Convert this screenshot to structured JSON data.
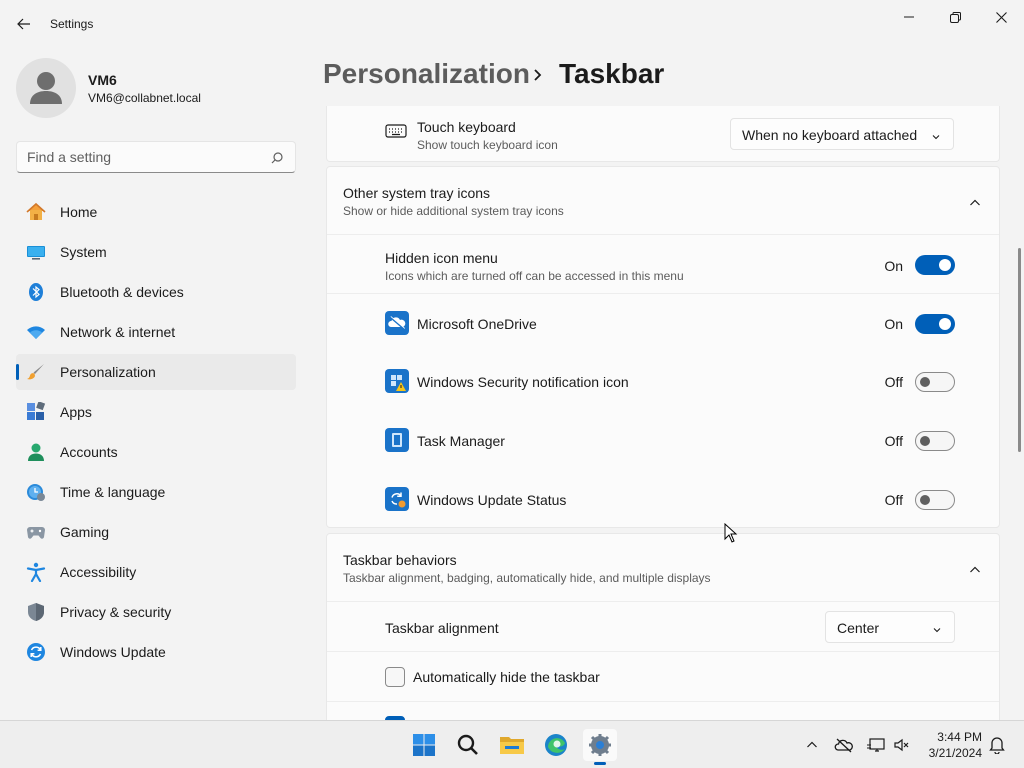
{
  "window": {
    "app_title": "Settings"
  },
  "profile": {
    "name": "VM6",
    "email": "VM6@collabnet.local"
  },
  "search": {
    "placeholder": "Find a setting"
  },
  "nav": {
    "items": [
      {
        "label": "Home",
        "icon": "home-icon"
      },
      {
        "label": "System",
        "icon": "monitor-icon"
      },
      {
        "label": "Bluetooth & devices",
        "icon": "bluetooth-icon"
      },
      {
        "label": "Network & internet",
        "icon": "wifi-icon"
      },
      {
        "label": "Personalization",
        "icon": "paintbrush-icon",
        "active": true
      },
      {
        "label": "Apps",
        "icon": "apps-icon"
      },
      {
        "label": "Accounts",
        "icon": "person-icon"
      },
      {
        "label": "Time & language",
        "icon": "clock-globe-icon"
      },
      {
        "label": "Gaming",
        "icon": "gamepad-icon"
      },
      {
        "label": "Accessibility",
        "icon": "accessibility-icon"
      },
      {
        "label": "Privacy & security",
        "icon": "shield-icon"
      },
      {
        "label": "Windows Update",
        "icon": "update-icon"
      }
    ]
  },
  "breadcrumb": {
    "parent": "Personalization",
    "separator": ">",
    "current": "Taskbar"
  },
  "touch_keyboard": {
    "title": "Touch keyboard",
    "subtitle": "Show touch keyboard icon",
    "dropdown_value": "When no keyboard attached"
  },
  "tray_icons": {
    "title": "Other system tray icons",
    "subtitle": "Show or hide additional system tray icons",
    "hidden_menu": {
      "title": "Hidden icon menu",
      "subtitle": "Icons which are turned off can be accessed in this menu",
      "state": "On"
    },
    "apps": [
      {
        "name": "Microsoft OneDrive",
        "state": "On",
        "icon": "onedrive-icon"
      },
      {
        "name": "Windows Security notification icon",
        "state": "Off",
        "icon": "windows-security-icon"
      },
      {
        "name": "Task Manager",
        "state": "Off",
        "icon": "task-manager-icon"
      },
      {
        "name": "Windows Update Status",
        "state": "Off",
        "icon": "windows-update-status-icon"
      }
    ]
  },
  "taskbar_behaviors": {
    "title": "Taskbar behaviors",
    "subtitle": "Taskbar alignment, badging, automatically hide, and multiple displays",
    "alignment": {
      "label": "Taskbar alignment",
      "value": "Center"
    },
    "auto_hide": {
      "label": "Automatically hide the taskbar",
      "checked": false
    }
  },
  "system_taskbar": {
    "apps": [
      "start-icon",
      "search-icon",
      "file-explorer-icon",
      "edge-icon",
      "settings-icon"
    ],
    "clock": {
      "time": "3:44 PM",
      "date": "3/21/2024"
    }
  },
  "colors": {
    "accent": "#005fb8",
    "background": "#f3f3f3",
    "card": "#fbfbfb"
  }
}
